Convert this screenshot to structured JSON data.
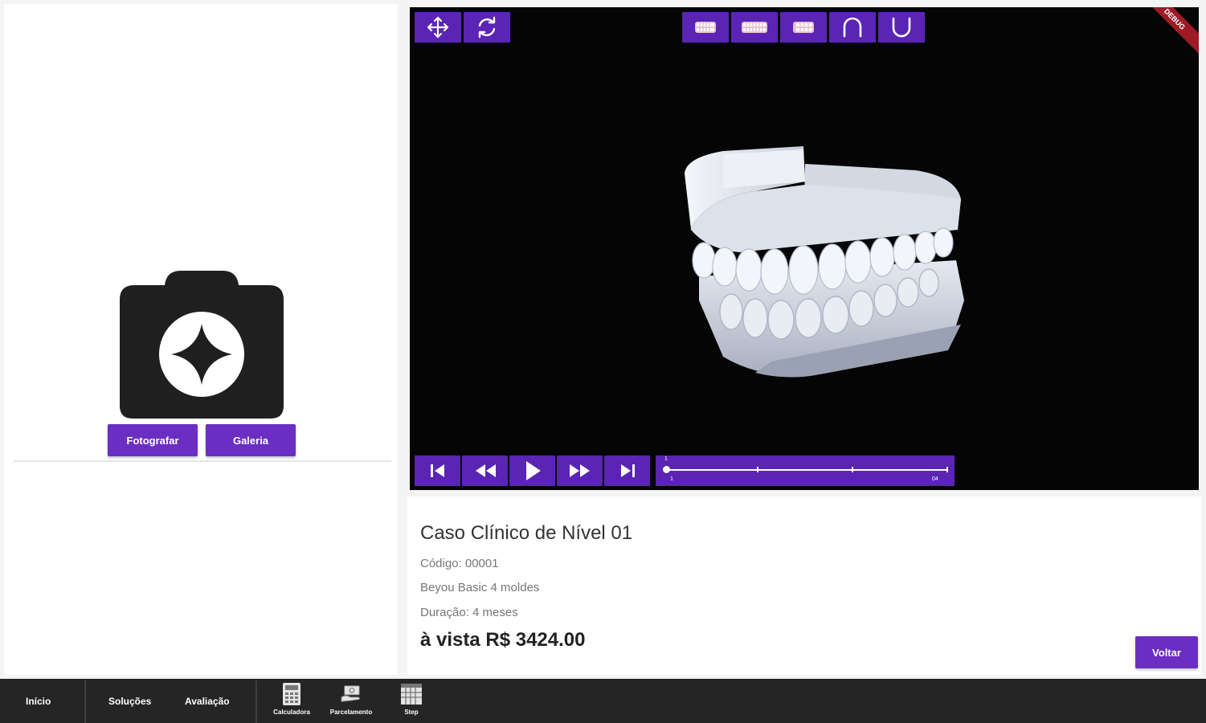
{
  "photo": {
    "camera_icon": "camera-sparkle-icon",
    "take_photo_label": "Fotografar",
    "gallery_label": "Galeria"
  },
  "viewer": {
    "debug_label": "DEBUG",
    "top_controls": [
      {
        "name": "move-tool",
        "icon": "move-arrows-icon"
      },
      {
        "name": "rotate-tool",
        "icon": "rotate-icon"
      }
    ],
    "view_controls": [
      {
        "name": "view-front",
        "icon": "teeth-front-icon"
      },
      {
        "name": "view-both",
        "icon": "teeth-both-icon"
      },
      {
        "name": "view-side",
        "icon": "teeth-side-icon"
      },
      {
        "name": "view-upper-arch",
        "icon": "upper-arch-icon"
      },
      {
        "name": "view-lower-arch",
        "icon": "lower-arch-icon"
      }
    ],
    "player_controls": [
      "skip-start-icon",
      "rewind-icon",
      "play-icon",
      "fast-forward-icon",
      "skip-end-icon"
    ],
    "timeline": {
      "start_label": "1",
      "end_label": "04",
      "position": 0
    },
    "model_accent": "#dfe3ee"
  },
  "case": {
    "title": "Caso Clínico de Nível 01",
    "code": "Código: 00001",
    "plan": "Beyou Basic 4 moldes",
    "duration": "Duração: 4 meses",
    "price": "à vista R$ 3424.00",
    "back_label": "Voltar"
  },
  "nav": {
    "inicio": "Início",
    "solucoes": "Soluções",
    "avaliacao": "Avaliação",
    "calculadora": "Calculadora",
    "parcelamento": "Parcelamento",
    "step": "Step"
  },
  "colors": {
    "accent": "#6a2fc2",
    "toolbar": "#5a24b4",
    "nav_bg": "#252525"
  }
}
